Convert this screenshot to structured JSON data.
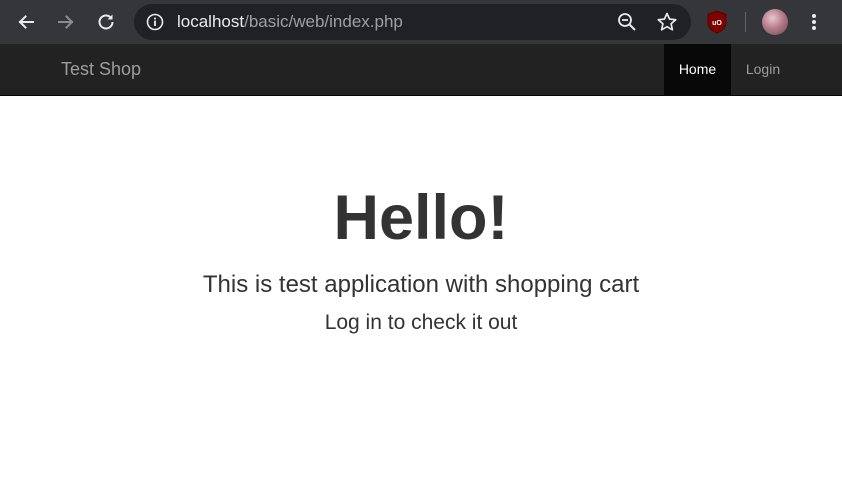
{
  "browser": {
    "url_host": "localhost",
    "url_path": "/basic/web/index.php",
    "icons": {
      "back": "back-arrow-icon",
      "forward": "forward-arrow-icon",
      "reload": "reload-icon",
      "site_info": "info-icon",
      "zoom": "zoom-out-icon",
      "bookmark": "star-icon",
      "extension": "ublock-origin-icon",
      "profile": "avatar",
      "menu": "kebab-menu-icon"
    },
    "colors": {
      "toolbar": "#35363a",
      "omnibox": "#202124",
      "host_text": "#e8eaed",
      "path_text": "#9aa0a6",
      "ublock": "#800000"
    },
    "extension_badge": "uO"
  },
  "navbar": {
    "brand": "Test Shop",
    "items": [
      {
        "label": "Home",
        "active": true
      },
      {
        "label": "Login",
        "active": false
      }
    ],
    "colors": {
      "background": "#222222",
      "active_bg": "#080808",
      "link": "#9d9d9d",
      "active_link": "#ffffff"
    }
  },
  "hero": {
    "title": "Hello!",
    "lead": "This is test application with shopping cart",
    "sub": "Log in to check it out"
  }
}
